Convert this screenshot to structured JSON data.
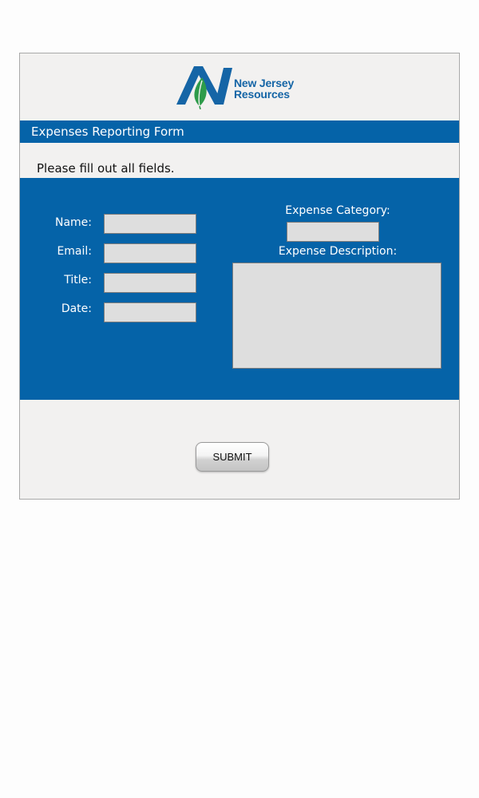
{
  "logo": {
    "line1": "New Jersey",
    "line2": "Resources",
    "brand_color": "#1565a6",
    "leaf_color": "#2e9b4a"
  },
  "form": {
    "title": "Expenses Reporting Form",
    "instructions": "Please fill out all fields.",
    "fields": {
      "name_label": "Name:",
      "email_label": "Email:",
      "title_label": "Title:",
      "date_label": "Date:",
      "category_label": "Expense Category:",
      "description_label": "Expense Description:"
    },
    "values": {
      "name": "",
      "email": "",
      "title": "",
      "date": "",
      "category": "",
      "description": ""
    },
    "submit_label": "SUBMIT"
  },
  "colors": {
    "panel_blue": "#0563a8",
    "card_background": "#f2f1f0",
    "field_background": "#dedede"
  }
}
